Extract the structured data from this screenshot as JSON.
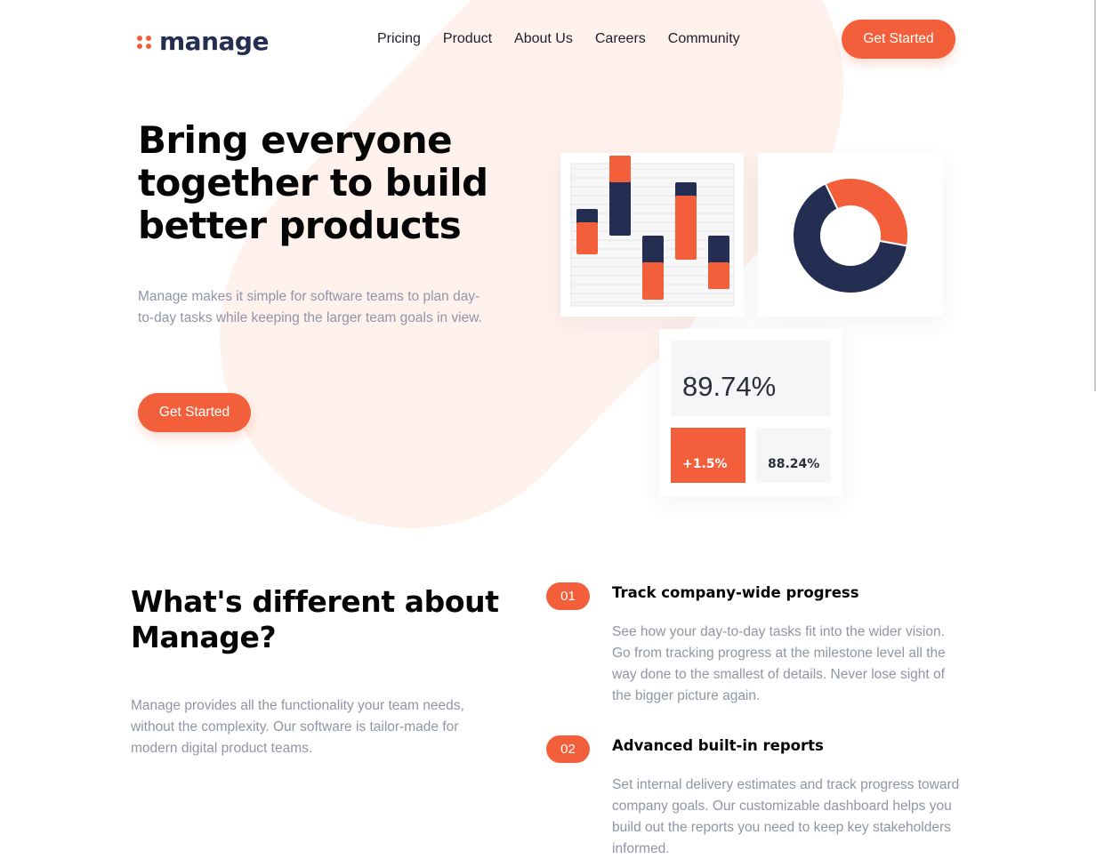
{
  "brand": {
    "name": "manage",
    "accent": "#f25f3a",
    "dark": "#242d52",
    "bg_tint": "#fff1ec"
  },
  "nav": {
    "items": [
      "Pricing",
      "Product",
      "About Us",
      "Careers",
      "Community"
    ]
  },
  "header_cta": "Get Started",
  "hero": {
    "title": "Bring everyone together to build better products",
    "description": "Manage makes it simple for software teams to plan day-to-day tasks while keeping the larger team goals in view.",
    "cta": "Get Started"
  },
  "dashboard": {
    "main_stat": "89.74%",
    "stat_a": "+1.5%",
    "stat_b": "88.24%"
  },
  "different": {
    "title": "What's different about Manage?",
    "description": "Manage provides all the functionality your team needs, without the complexity. Our software is tailor-made for modern digital product teams."
  },
  "features": [
    {
      "number": "01",
      "title": "Track company-wide progress",
      "body": "See how your day-to-day tasks fit into the wider vision. Go from tracking progress at the milestone level all the way done to the smallest of details. Never lose sight of the bigger picture again."
    },
    {
      "number": "02",
      "title": "Advanced built-in reports",
      "body": "Set internal delivery estimates and track progress toward company goals. Our customizable dashboard helps you build out the reports you need to keep key stakeholders informed."
    }
  ],
  "chart_data": [
    {
      "type": "bar",
      "series": [
        {
          "values": [
            1,
            3,
            -2,
            2,
            -2
          ]
        },
        {
          "values": [
            1.2,
            1,
            1.4,
            2.4,
            1
          ]
        }
      ]
    },
    {
      "type": "pie",
      "values": [
        35,
        65
      ],
      "colors": [
        "#f25f3a",
        "#242d52"
      ]
    }
  ]
}
